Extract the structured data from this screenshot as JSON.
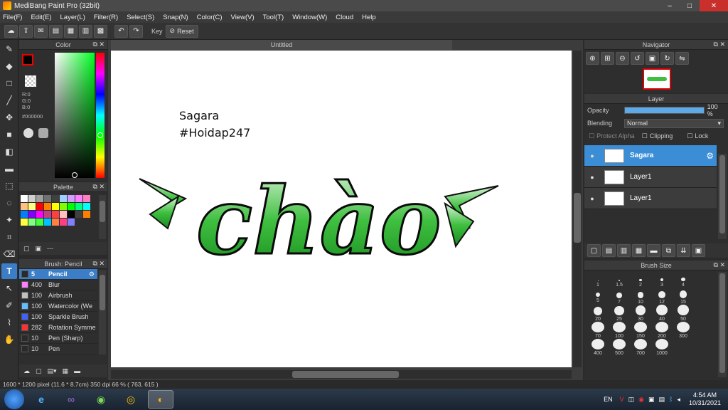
{
  "window": {
    "title": "MediBang Paint Pro (32bit)",
    "controls": [
      "–",
      "□",
      "✕"
    ]
  },
  "menu": [
    "File(F)",
    "Edit(E)",
    "Layer(L)",
    "Filter(R)",
    "Select(S)",
    "Snap(N)",
    "Color(C)",
    "View(V)",
    "Tool(T)",
    "Window(W)",
    "Cloud",
    "Help"
  ],
  "toolbar": {
    "key_label": "Key",
    "reset_label": "Reset"
  },
  "color_panel": {
    "title": "Color",
    "r": "R:0",
    "g": "G:0",
    "b": "B:0",
    "hex": "#000000",
    "fg_color": "#000000"
  },
  "palette_panel": {
    "title": "Palette",
    "more": "---",
    "swatches": [
      "#ffffff",
      "#d0d0d0",
      "#a0a0a0",
      "#707070",
      "#404040",
      "#a0d0ff",
      "#d0a0ff",
      "#ff80ff",
      "#ff80c0",
      "#ffc080",
      "#ffff80",
      "#ff0000",
      "#ff8000",
      "#ffff00",
      "#80ff00",
      "#00ff00",
      "#00ff80",
      "#00ffff",
      "#0080ff",
      "#8000ff",
      "#ff00ff",
      "#c04080",
      "#ff4040",
      "#ffc0c0",
      "#000000",
      "#404040",
      "#ff8000",
      "#ffff40",
      "#80ff80",
      "#40ff40",
      "#00c0ff",
      "#ff8040",
      "#ff4080",
      "#8080ff"
    ]
  },
  "brush_panel": {
    "title": "Brush: Pencil",
    "items": [
      {
        "size": "5",
        "name": "Pencil",
        "color": "#2a2a2a"
      },
      {
        "size": "400",
        "name": "Blur",
        "color": "#ff80ff"
      },
      {
        "size": "100",
        "name": "Airbrush",
        "color": "#c0c0c0"
      },
      {
        "size": "100",
        "name": "Watercolor (We",
        "color": "#60c0ff"
      },
      {
        "size": "100",
        "name": "Sparkle Brush",
        "color": "#4060ff"
      },
      {
        "size": "282",
        "name": "Rotation Symme",
        "color": "#ff3030"
      },
      {
        "size": "10",
        "name": "Pen (Sharp)",
        "color": "#2a2a2a"
      },
      {
        "size": "10",
        "name": "Pen",
        "color": "#2a2a2a"
      }
    ]
  },
  "canvas": {
    "tab_title": "Untitled",
    "text_line1": "Sagara",
    "text_line2": "#Hoidap247",
    "art_word": "chào"
  },
  "navigator": {
    "title": "Navigator"
  },
  "layer_panel": {
    "title": "Layer",
    "opacity_label": "Opacity",
    "opacity_value": "100 %",
    "opacity_fraction": 1.0,
    "blending_label": "Blending",
    "blending_value": "Normal",
    "protect_alpha": "Protect Alpha",
    "clipping": "Clipping",
    "lock": "Lock",
    "layers": [
      {
        "name": "Sagara",
        "selected": true
      },
      {
        "name": "Layer1",
        "selected": false
      },
      {
        "name": "Layer1",
        "selected": false
      }
    ]
  },
  "brush_size_panel": {
    "title": "Brush Size",
    "sizes": [
      "1",
      "1.5",
      "2",
      "3",
      "4",
      "5",
      "7",
      "10",
      "12",
      "15",
      "20",
      "25",
      "30",
      "40",
      "50",
      "70",
      "100",
      "150",
      "200",
      "300",
      "400",
      "500",
      "700",
      "1000"
    ]
  },
  "status": {
    "text": "1600 * 1200 pixel   (11.6 * 8.7cm)   350 dpi   66 %   ( 763, 615 )"
  },
  "taskbar": {
    "lang": "EN",
    "time": "4:54 AM",
    "date": "10/31/2021"
  }
}
